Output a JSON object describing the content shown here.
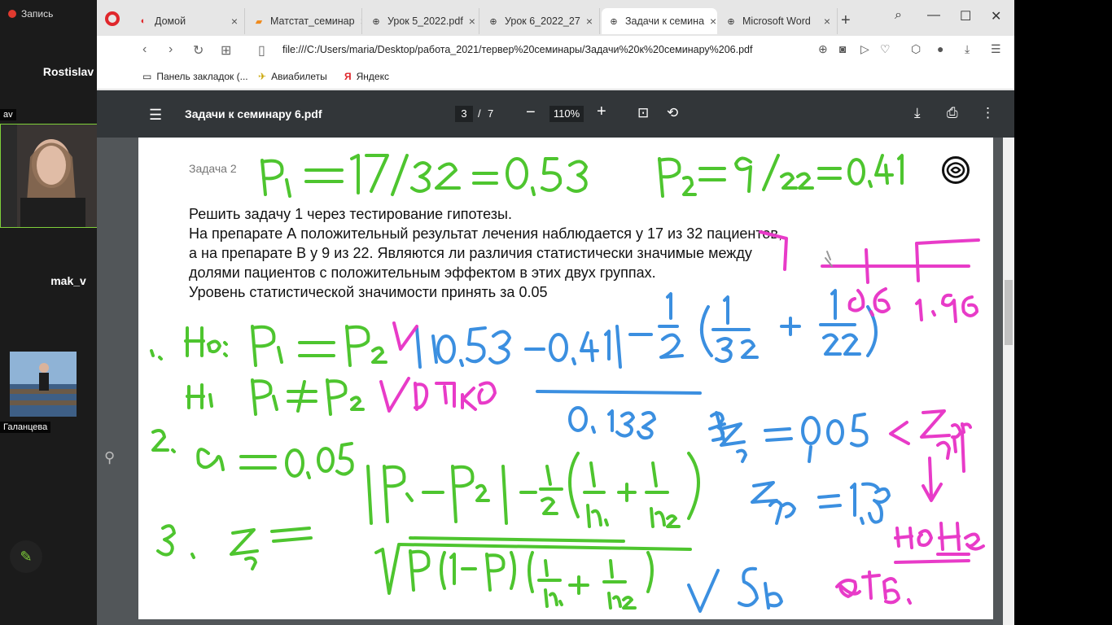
{
  "call": {
    "recording_label": "Запись",
    "participants": [
      {
        "name": "Rostislav"
      },
      {
        "name": "mak_v"
      }
    ],
    "video_label_1": "av",
    "video_label_2": "Галанцева"
  },
  "browser": {
    "tabs": [
      {
        "label": "Домой",
        "icon": "opera-home-icon"
      },
      {
        "label": "Матстат_семинар",
        "icon": "document-icon"
      },
      {
        "label": "Урок 5_2022.pdf",
        "icon": "globe-icon"
      },
      {
        "label": "Урок 6_2022_27",
        "icon": "globe-icon"
      },
      {
        "label": "Задачи к семина",
        "icon": "globe-icon",
        "active": true
      },
      {
        "label": "Microsoft Word",
        "icon": "globe-icon"
      }
    ],
    "url": "file:///C:/Users/maria/Desktop/работа_2021/тервер%20семинары/Задачи%20к%20семинару%206.pdf",
    "bookmarks": [
      {
        "label": "Панель закладок (..."
      },
      {
        "label": "Авиабилеты"
      },
      {
        "label": "Яндекс"
      }
    ]
  },
  "pdf": {
    "title": "Задачи к семинару 6.pdf",
    "page": "3",
    "separator": "/",
    "total_pages": "7",
    "zoom": "110%"
  },
  "document": {
    "task_number": "Задача 2",
    "lines": [
      "Решить задачу 1 через тестирование гипотезы.",
      "На препарате А положительный результат лечения наблюдается у 17 из 32 пациентов,",
      "а на препарате В у 9 из 22. Являются ли различия статистически значимые между",
      "долями пациентов с положительным эффектом в этих двух группах.",
      "Уровень статистической значимости принять за 0.05"
    ]
  },
  "colors": {
    "ink_green": "#4ec52f",
    "ink_blue": "#3b8fe0",
    "ink_pink": "#e83bc8",
    "accent_browser": "#e0272c"
  }
}
